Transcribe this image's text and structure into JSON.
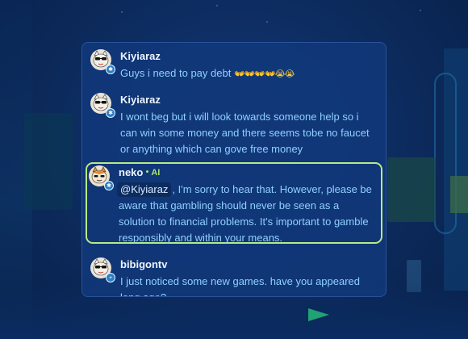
{
  "messages": [
    {
      "username": "Kiyiaraz",
      "text": "Guys i need to pay debt",
      "emojis": "👐👐👐👐😭😭",
      "badge": "✱"
    },
    {
      "username": "Kiyiaraz",
      "text": "I wont beg but i will look towards someone help so i can win some money and there seems tobe no faucet or anything which can gove free money",
      "badge": "✱"
    },
    {
      "username": "neko",
      "tag": "AI",
      "mention": "@Kiyiaraz",
      "text": ", I'm sorry to hear that. However, please be aware that gambling should never be seen as a solution to financial problems. It's important to gamble responsibly and within your means.",
      "badge": "✱"
    },
    {
      "username": "bibigontv",
      "text": "I just noticed some new games. have you appeared long ago?",
      "badge": "+"
    }
  ],
  "colors": {
    "panel_bg": "#11387a",
    "username": "#eef4ff",
    "message_text": "#8fd0ff",
    "ai_highlight_border": "#b8e986",
    "ai_tag": "#a8e37c"
  },
  "icons": {
    "avatar": "cat-avatar-icon",
    "badge_level": "level-badge-icon",
    "badge_plus": "plus-badge-icon"
  }
}
